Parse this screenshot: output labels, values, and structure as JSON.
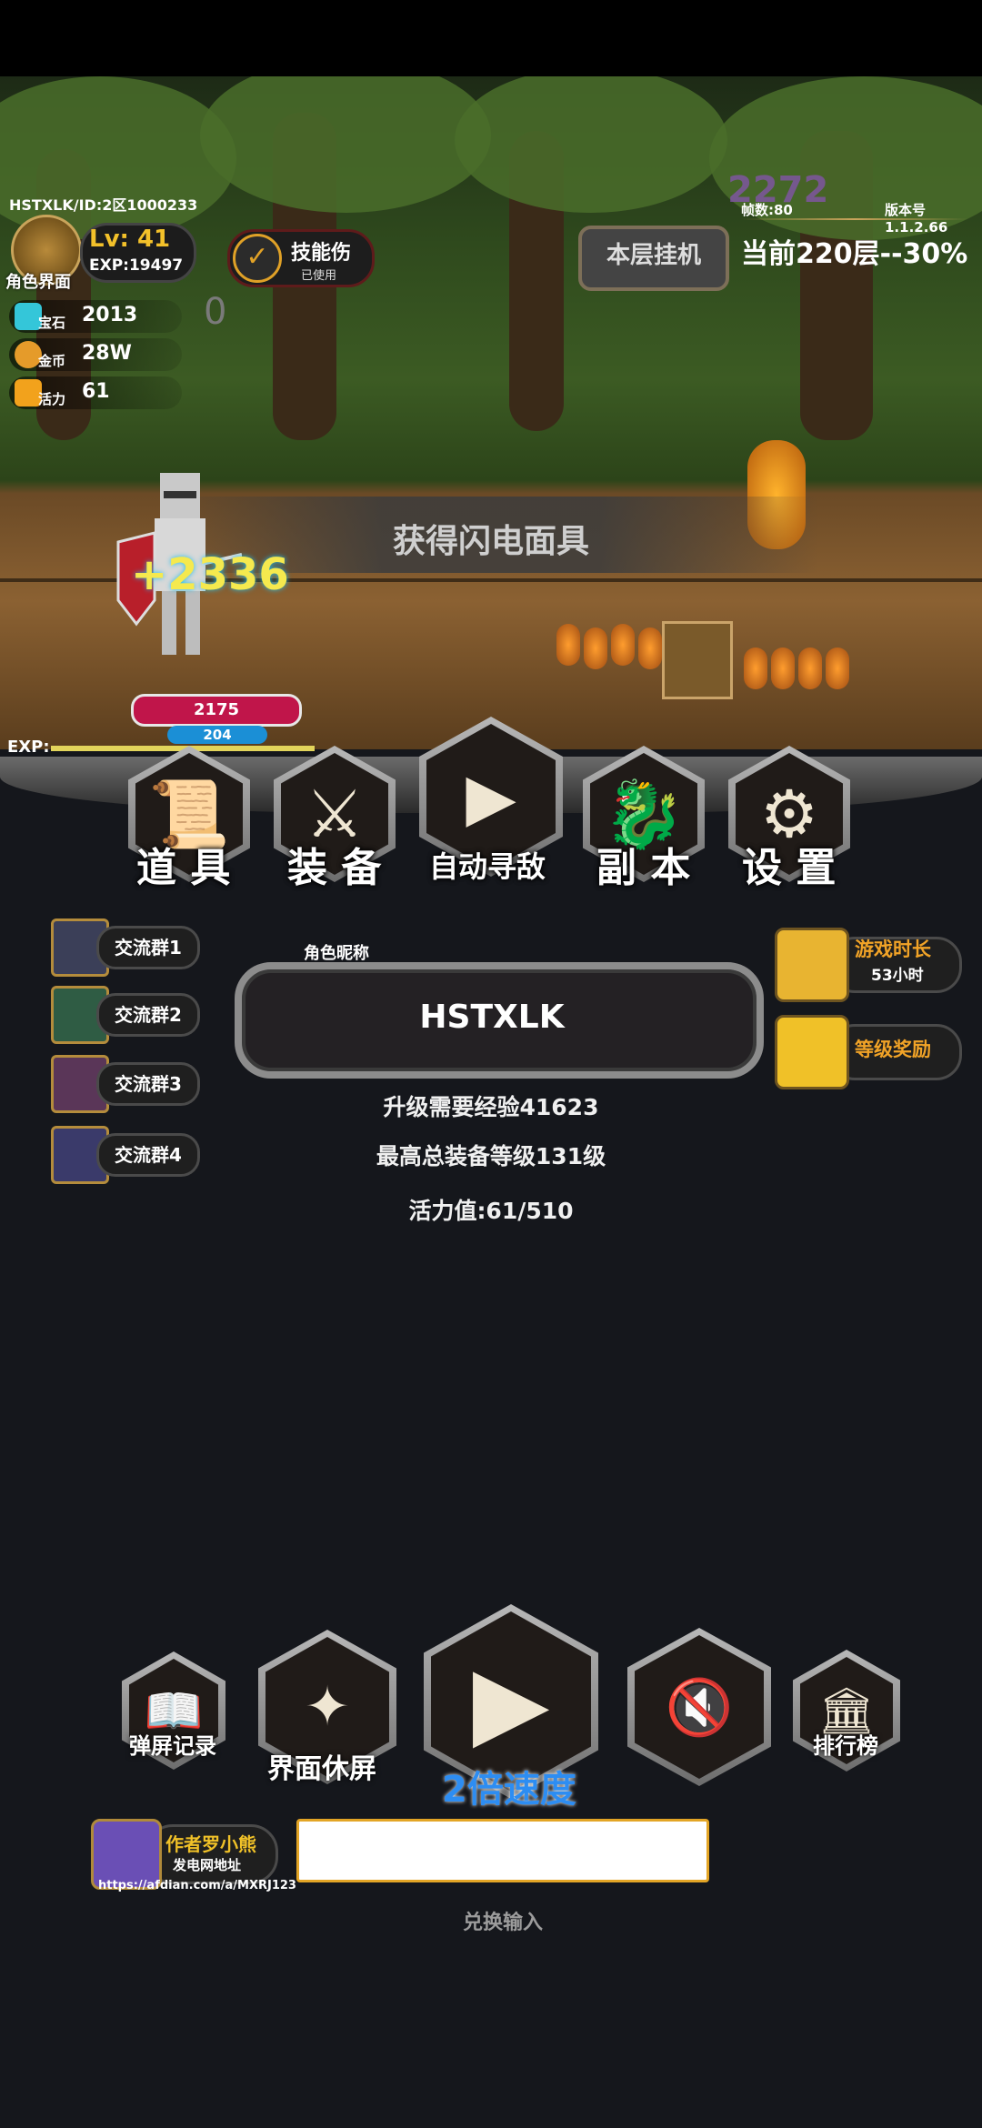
{
  "player": {
    "id_text": "HSTXLK/ID:2区1000233",
    "avatar_label": "角色界面",
    "level_label": "Lv: 41",
    "exp_label": "EXP:19497"
  },
  "stats": [
    {
      "name": "宝石",
      "value": "2013"
    },
    {
      "name": "金币",
      "value": "28W"
    },
    {
      "name": "活力",
      "value": "61"
    }
  ],
  "hud": {
    "skill_label": "技能伤",
    "skill_sub": "已使用",
    "afk_button": "本层挂机",
    "fps": "帧数:80",
    "version": "版本号1.1.2.66",
    "floor_progress": "当前220层--30%",
    "floating_number": "2272",
    "zero_text": "0"
  },
  "battle": {
    "loot_banner": "获得闪电面具",
    "damage_text": "+2336",
    "hp": "2175",
    "mp": "204",
    "exp_label": "EXP:"
  },
  "menu": [
    {
      "label": "道 具",
      "icon": "scroll-icon"
    },
    {
      "label": "装 备",
      "icon": "sword-icon"
    },
    {
      "label": "自动寻敌",
      "icon": "play-icon"
    },
    {
      "label": "副 本",
      "icon": "dragon-icon"
    },
    {
      "label": "设 置",
      "icon": "gear-icon"
    }
  ],
  "groups": [
    "交流群1",
    "交流群2",
    "交流群3",
    "交流群4"
  ],
  "right_buttons": {
    "playtime_title": "游戏时长",
    "playtime_value": "53小时",
    "level_reward": "等级奖励"
  },
  "profile": {
    "nickname_label": "角色昵称",
    "nickname": "HSTXLK",
    "exp_needed": "升级需要经验41623",
    "max_gear_level": "最高总装备等级131级",
    "stamina": "活力值:61/510"
  },
  "bottom": {
    "danmaku": "弹屏记录",
    "screensaver": "界面休屏",
    "speed": "2倍速度",
    "ranking": "排行榜"
  },
  "author": {
    "name": "作者罗小熊",
    "sub": "发电网地址",
    "url": "https://afdian.com/a/MXRJ123"
  },
  "redeem": {
    "value": "",
    "label": "兑换输入"
  },
  "colors": {
    "accent_gold": "#f3c12a",
    "hp_red": "#c0154a",
    "mp_blue": "#1b8fd6",
    "speed_blue": "#2d8df2"
  }
}
